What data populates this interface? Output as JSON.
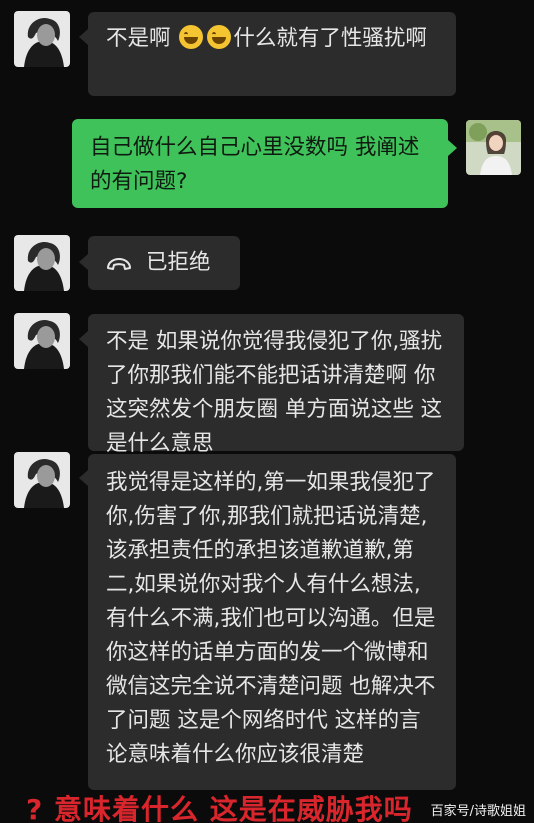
{
  "messages": [
    {
      "side": "in",
      "text_a": "不是啊 ",
      "text_b": "什么就有了性骚扰啊",
      "emojis": [
        "grinning-sweat-emoji",
        "grinning-sweat-emoji"
      ]
    },
    {
      "side": "out",
      "text": "自己做什么自己心里没数吗 我阐述的有问题?"
    },
    {
      "side": "in",
      "type": "call",
      "text": "已拒绝",
      "icon": "declined-call-icon"
    },
    {
      "side": "in",
      "text": "不是 如果说你觉得我侵犯了你,骚扰了你那我们能不能把话讲清楚啊 你这突然发个朋友圈  单方面说这些  这是什么意思"
    },
    {
      "side": "in",
      "text": "我觉得是这样的,第一如果我侵犯了你,伤害了你,那我们就把话说清楚,该承担责任的承担该道歉道歉,第二,如果说你对我个人有什么想法,有什么不满,我们也可以沟通。但是你这样的话单方面的发一个微博和微信这完全说不清楚问题 也解决不了问题 这是个网络时代 这样的言论意味着什么你应该很清楚"
    }
  ],
  "caption": "? 意味着什么 这是在威胁我吗",
  "watermark": "百家号/诗歌姐姐",
  "colors": {
    "sent_bubble": "#3fc25a",
    "received_bubble": "#2c2c2c",
    "caption": "#d8262c",
    "background": "#0b0b0b"
  }
}
